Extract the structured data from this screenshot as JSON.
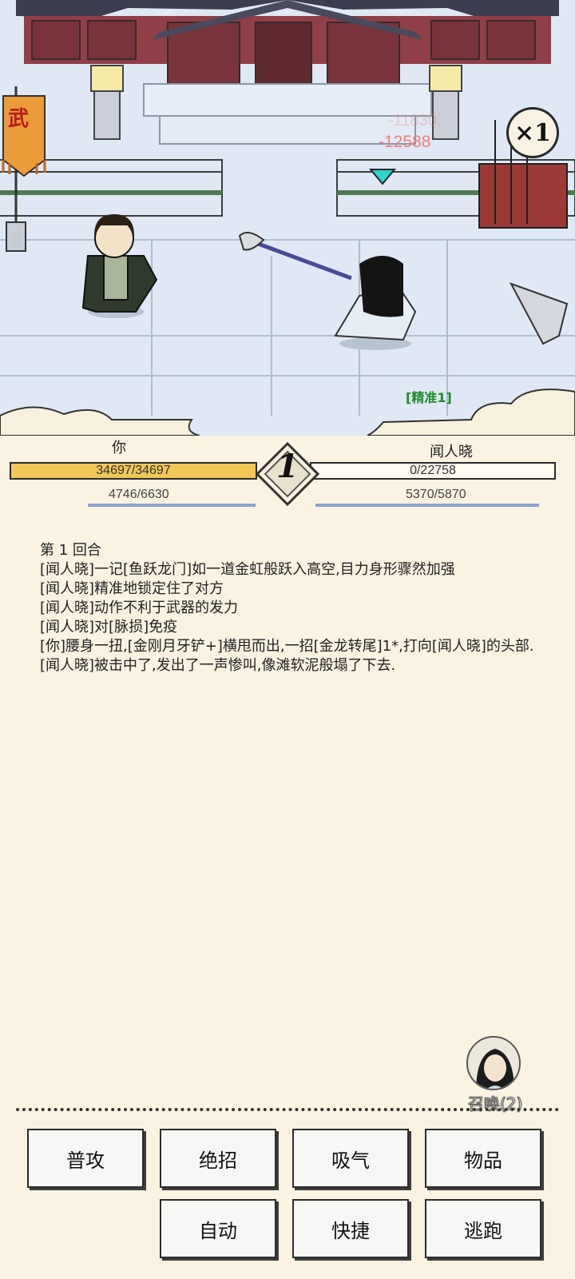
{
  "scene": {
    "banner_char": "武",
    "speed_label": "×1",
    "damage_popup": "-12588",
    "damage_popup_ghost": "-11830",
    "status_tag": "[精准1]",
    "colors": {
      "hp": "#f1c75a",
      "mp": "#8da3d2",
      "damage": "#ef7d7d",
      "tag": "#1f8a2a"
    }
  },
  "status": {
    "player": {
      "name": "你",
      "hp_text": "34697/34697",
      "hp_fraction": 1.0,
      "mp_text": "4746/6630",
      "mp_fraction": 0.716
    },
    "enemy": {
      "name": "闻人晓",
      "hp_text": "0/22758",
      "hp_fraction": 0.0,
      "mp_text": "5370/5870",
      "mp_fraction": 0.915
    },
    "round": "1"
  },
  "log": [
    "第 1 回合",
    "[闻人晓]一记[鱼跃龙门]如一道金虹般跃入高空,目力身形骤然加强",
    "[闻人晓]精准地锁定住了对方",
    "[闻人晓]动作不利于武器的发力",
    "[闻人晓]对[脉损]免疫",
    "[你]腰身一扭,[金刚月牙铲+]横甩而出,一招[金龙转尾]1*,打向[闻人晓]的头部.",
    "[闻人晓]被击中了,发出了一声惨叫,像滩软泥般塌了下去."
  ],
  "summon": {
    "label": "召唤(2)"
  },
  "buttons": {
    "attack": "普攻",
    "ultimate": "绝招",
    "breathe": "吸气",
    "items": "物品",
    "auto": "自动",
    "quick": "快捷",
    "flee": "逃跑"
  }
}
